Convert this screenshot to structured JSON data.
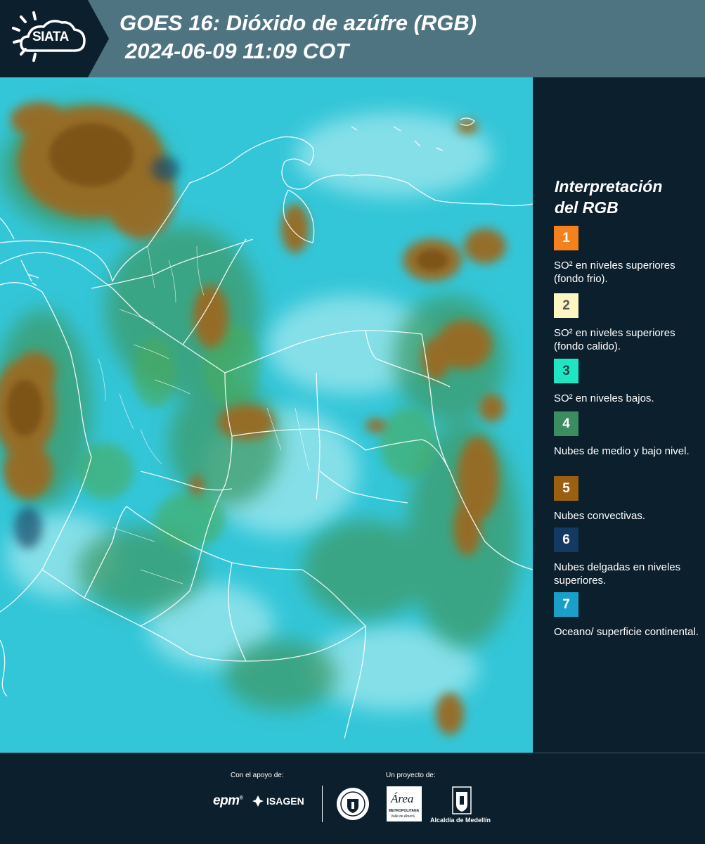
{
  "header": {
    "logo_text": "SIATA",
    "title": "GOES 16: Dióxido de azúfre (RGB)",
    "subtitle": "2024-06-09 11:09 COT"
  },
  "legend": {
    "title_line1": "Interpretación",
    "title_line2": "del RGB",
    "items": [
      {
        "number": "1",
        "color": "#f5801e",
        "text_color": "#ffffff",
        "desc": "SO² en niveles superiores (fondo frio)."
      },
      {
        "number": "2",
        "color": "#fdf6c3",
        "text_color": "#555555",
        "desc": "SO² en niveles superiores (fondo calido)."
      },
      {
        "number": "3",
        "color": "#1ee6c3",
        "text_color": "#1e4a4a",
        "desc": "SO² en niveles bajos."
      },
      {
        "number": "4",
        "color": "#3b8c60",
        "text_color": "#ffffff",
        "desc": "Nubes de medio y bajo nivel."
      },
      {
        "number": "5",
        "color": "#9a5f10",
        "text_color": "#ffffff",
        "desc": "Nubes convectivas."
      },
      {
        "number": "6",
        "color": "#143a64",
        "text_color": "#ffffff",
        "desc": "Nubes delgadas en niveles superiores."
      },
      {
        "number": "7",
        "color": "#1aa0c8",
        "text_color": "#ffffff",
        "desc": "Oceano/ superficie continental."
      }
    ]
  },
  "footer": {
    "support_label": "Con el apoyo de:",
    "project_label": "Un proyecto de:",
    "sponsor_epm": "epm",
    "sponsor_isagen": "ISAGEN",
    "area_name": "Área",
    "area_sub1": "METROPOLITANA",
    "area_sub2": "Valle de Aburrá",
    "alcaldia": "Alcaldía de Medellín"
  },
  "colors": {
    "header_bg": "#4e7482",
    "panel_bg": "#0c1f2c",
    "map_base": "#2fc3d6"
  }
}
